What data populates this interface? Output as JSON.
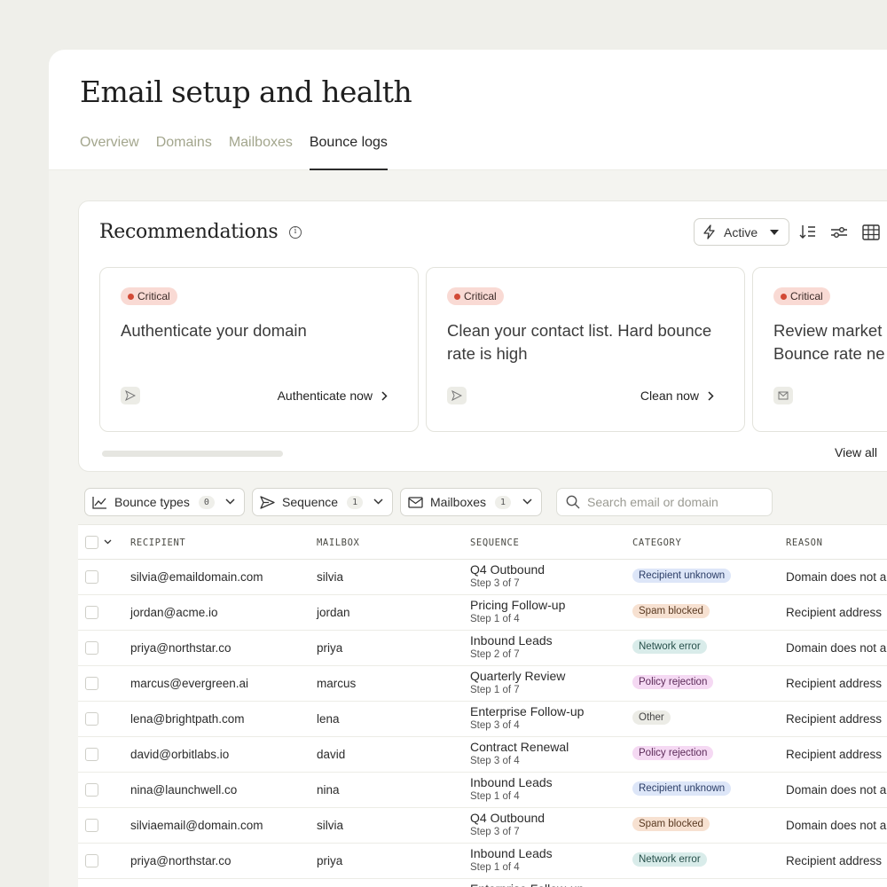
{
  "page": {
    "title": "Email setup and health",
    "tabs": [
      {
        "label": "Overview",
        "active": false
      },
      {
        "label": "Domains",
        "active": false
      },
      {
        "label": "Mailboxes",
        "active": false
      },
      {
        "label": "Bounce logs",
        "active": true
      }
    ]
  },
  "recommendations": {
    "title": "Recommendations",
    "filter_label": "Active",
    "view_all_label": "View all",
    "items": [
      {
        "badge": "Critical",
        "text": "Authenticate your domain",
        "action": "Authenticate now",
        "icon": "send-icon"
      },
      {
        "badge": "Critical",
        "text": "Clean your contact list. Hard bounce rate is high",
        "action": "Clean now",
        "icon": "send-icon"
      },
      {
        "badge": "Critical",
        "text": "Review market Bounce rate ne",
        "action": "",
        "icon": "mail-icon"
      }
    ]
  },
  "filters": {
    "bounce_types": {
      "label": "Bounce types",
      "count": "0"
    },
    "sequence": {
      "label": "Sequence",
      "count": "1"
    },
    "mailboxes": {
      "label": "Mailboxes",
      "count": "1"
    },
    "search_placeholder": "Search email or domain"
  },
  "table": {
    "columns": [
      "RECIPIENT",
      "MAILBOX",
      "SEQUENCE",
      "CATEGORY",
      "REASON"
    ],
    "rows": [
      {
        "recipient": "silvia@emaildomain.com",
        "mailbox": "silvia",
        "sequence": "Q4 Outbound",
        "step": "Step 3 of 7",
        "category": "Recipient unknown",
        "reason": "Domain does not a"
      },
      {
        "recipient": "jordan@acme.io",
        "mailbox": "jordan",
        "sequence": "Pricing Follow-up",
        "step": "Step 1 of 4",
        "category": "Spam blocked",
        "reason": "Recipient address"
      },
      {
        "recipient": "priya@northstar.co",
        "mailbox": "priya",
        "sequence": "Inbound Leads",
        "step": "Step 2 of 7",
        "category": "Network error",
        "reason": "Domain does not a"
      },
      {
        "recipient": "marcus@evergreen.ai",
        "mailbox": "marcus",
        "sequence": "Quarterly Review",
        "step": "Step 1 of 7",
        "category": "Policy rejection",
        "reason": "Recipient address"
      },
      {
        "recipient": "lena@brightpath.com",
        "mailbox": "lena",
        "sequence": "Enterprise Follow-up",
        "step": "Step 3 of 4",
        "category": "Other",
        "reason": "Recipient address"
      },
      {
        "recipient": "david@orbitlabs.io",
        "mailbox": "david",
        "sequence": "Contract Renewal",
        "step": "Step 3 of 4",
        "category": "Policy rejection",
        "reason": "Recipient address"
      },
      {
        "recipient": "nina@launchwell.co",
        "mailbox": "nina",
        "sequence": "Inbound Leads",
        "step": "Step 1 of 4",
        "category": "Recipient unknown",
        "reason": "Domain does not a"
      },
      {
        "recipient": "silviaemail@domain.com",
        "mailbox": "silvia",
        "sequence": "Q4 Outbound",
        "step": "Step 3 of 7",
        "category": "Spam blocked",
        "reason": "Domain does not a"
      },
      {
        "recipient": "priya@northstar.co",
        "mailbox": "priya",
        "sequence": "Inbound Leads",
        "step": "Step 1 of 4",
        "category": "Network error",
        "reason": "Recipient address"
      },
      {
        "recipient": "",
        "mailbox": "",
        "sequence": "Enterprise Follow-up",
        "step": "",
        "category": "",
        "reason": ""
      }
    ]
  },
  "category_colors": {
    "Recipient unknown": {
      "bg": "#dde6f8",
      "fg": "#2b3d66"
    },
    "Spam blocked": {
      "bg": "#f7e1d1",
      "fg": "#5a3a22"
    },
    "Network error": {
      "bg": "#d9ecea",
      "fg": "#27504b"
    },
    "Policy rejection": {
      "bg": "#f5d9f3",
      "fg": "#5b2a58"
    },
    "Other": {
      "bg": "#ececE6",
      "fg": "#444444"
    }
  }
}
